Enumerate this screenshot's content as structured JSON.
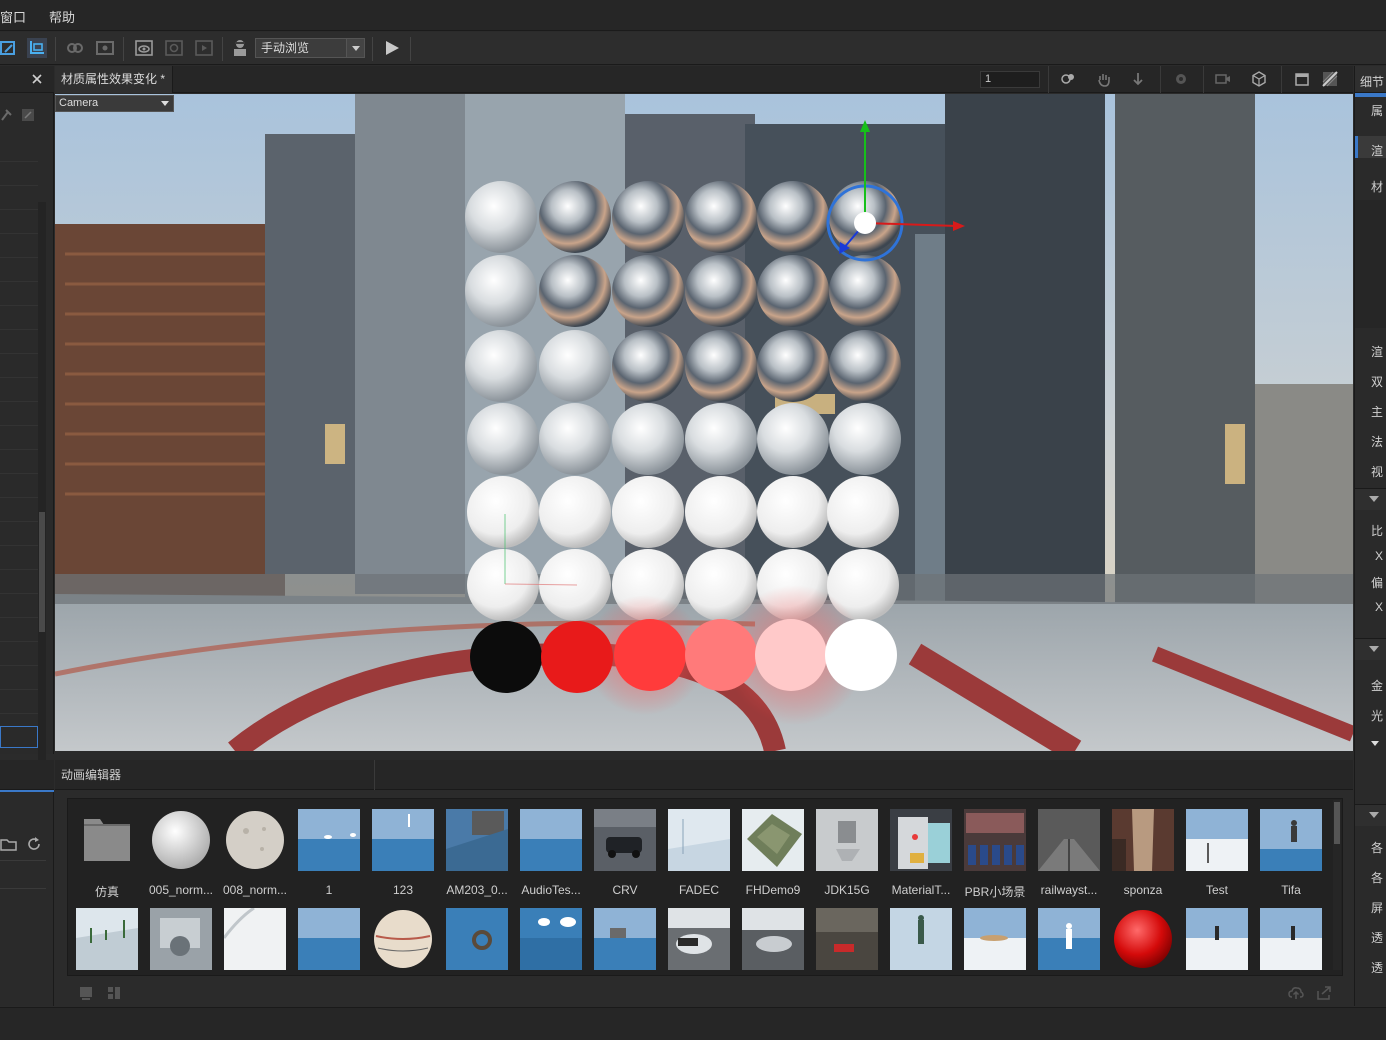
{
  "menubar": {
    "items": [
      "窗口",
      "帮助"
    ]
  },
  "toolbar": {
    "mode_value": "手动浏览"
  },
  "viewport_tab": {
    "title": "材质属性效果变化 *",
    "frame_value": "1"
  },
  "camera": {
    "selected": "Camera"
  },
  "right_panel": {
    "tab_label": "细节",
    "labels": [
      "属",
      "渲",
      "材",
      "渲",
      "双",
      "主",
      "法",
      "视",
      "比",
      "X",
      "偏",
      "X",
      "金",
      "光",
      "各",
      "各",
      "屏",
      "透",
      "透"
    ]
  },
  "anim_editor": {
    "title": "动画编辑器"
  },
  "assets": {
    "row1": [
      "仿真",
      "005_norm...",
      "008_norm...",
      "1",
      "123",
      "AM203_0...",
      "AudioTes...",
      "CRV",
      "FADEC",
      "FHDemo9",
      "JDK15G",
      "MaterialT...",
      "PBR小场景",
      "railwayst...",
      "sponza",
      "Test",
      "Tifa"
    ],
    "row2_count": 17
  },
  "colors": {
    "accent": "#3a78c8",
    "panel": "#2a2a2a",
    "toolbar": "#2d2d2d"
  }
}
